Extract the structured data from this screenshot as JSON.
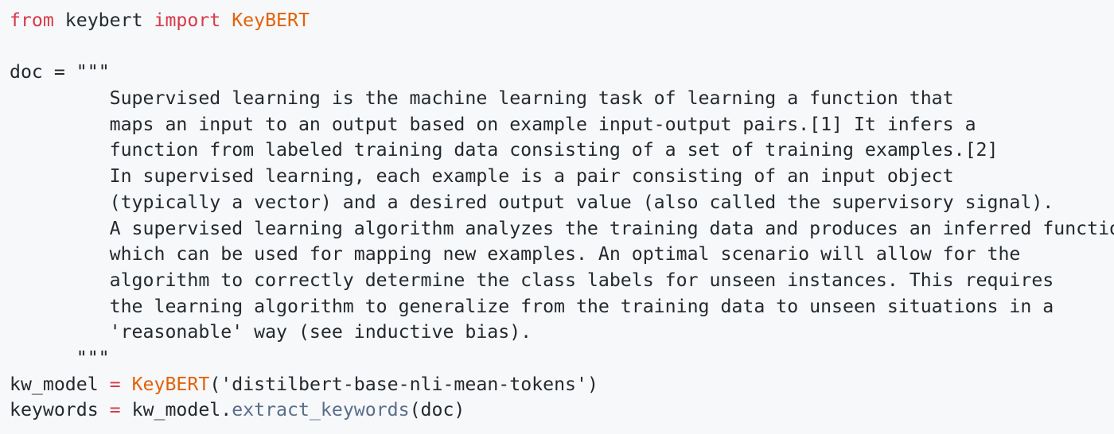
{
  "code": {
    "line1": {
      "from_kw": "from",
      "module": " keybert ",
      "import_kw": "import",
      "sp": " ",
      "cls": "KeyBERT"
    },
    "line3": {
      "var": "doc",
      "eq": " = ",
      "open_quote": "\"\"\""
    },
    "docstring": [
      "         Supervised learning is the machine learning task of learning a function that",
      "         maps an input to an output based on example input-output pairs.[1] It infers a",
      "         function from labeled training data consisting of a set of training examples.[2]",
      "         In supervised learning, each example is a pair consisting of an input object",
      "         (typically a vector) and a desired output value (also called the supervisory signal).",
      "         A supervised learning algorithm analyzes the training data and produces an inferred function,",
      "         which can be used for mapping new examples. An optimal scenario will allow for the",
      "         algorithm to correctly determine the class labels for unseen instances. This requires",
      "         the learning algorithm to generalize from the training data to unseen situations in a",
      "         'reasonable' way (see inductive bias)."
    ],
    "close_quote": "      \"\"\"",
    "line_model": {
      "var": "kw_model",
      "eq": " = ",
      "cls": "KeyBERT",
      "arg": "('distilbert-base-nli-mean-tokens')"
    },
    "line_keywords": {
      "var": "keywords",
      "eq": " = ",
      "obj": "kw_model.",
      "method": "extract_keywords",
      "arg": "(doc)"
    }
  },
  "colors": {
    "background": "#f6f8fa",
    "keyword": "#d73a49",
    "class_name": "#e36209",
    "text": "#24292e"
  }
}
